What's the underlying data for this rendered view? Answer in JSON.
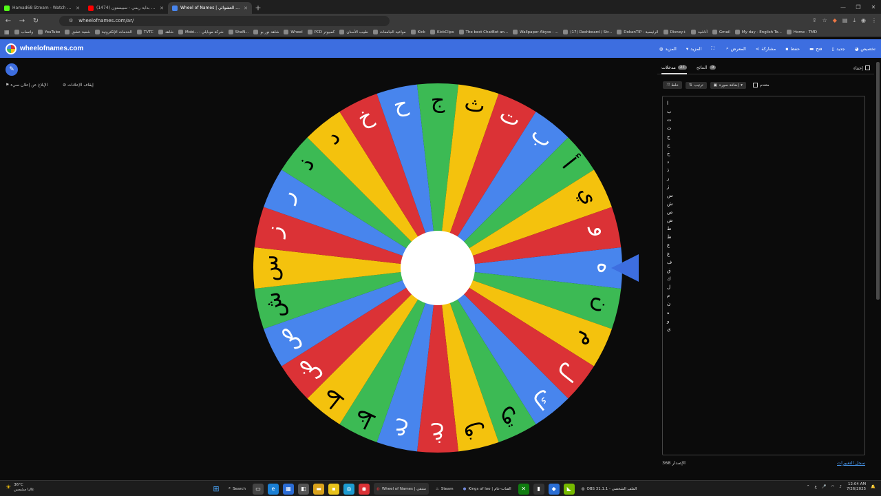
{
  "browser": {
    "tabs": [
      {
        "title": "Hamad68 Stream - Watch Live on Ki",
        "color": "#53fc18",
        "active": false
      },
      {
        "title": "(1474) أغنية بداية ريمي - سبيستون",
        "color": "#ff0000",
        "active": false
      },
      {
        "title": "Wheel of Names | اسم العشوائي",
        "color": "#4885ed",
        "active": true
      }
    ],
    "new_tab": "+",
    "url": "wheelofnames.com/ar/",
    "bookmarks": [
      "واتساب",
      "YouTube",
      "شعبة عشق",
      "الخدمات الإلكترونية",
      "TVTC",
      "شاهد",
      "Mobi... - شركة موبايلي",
      "ShaN...",
      "شاهد نور بو",
      "Wheel",
      "PCD كمبيوتر",
      "طبيب الأسنان",
      "مواعيد الجامعات",
      "Kick",
      "KickClips",
      "The best ChatBot an...",
      "Wallpaper Abyss - ...",
      "(17) Dashboard / Str...",
      "DokanTIP - الرئيسية",
      "Disney+",
      "أناشيد",
      "Gmail",
      "My day - English Te...",
      "Home - TMD"
    ]
  },
  "app": {
    "site_name": "wheelofnames.com",
    "menu": [
      {
        "label": "المزيد",
        "icon": "globe-icon"
      },
      {
        "label": "المزيد",
        "icon": "chevron-down-icon"
      },
      {
        "label": "",
        "icon": "fullscreen-icon"
      },
      {
        "label": "المعرض",
        "icon": "search-icon"
      },
      {
        "label": "مشاركة",
        "icon": "share-icon"
      },
      {
        "label": "حفظ",
        "icon": "save-icon"
      },
      {
        "label": "فتح",
        "icon": "folder-icon"
      },
      {
        "label": "جديد",
        "icon": "file-icon"
      },
      {
        "label": "تخصيص",
        "icon": "palette-icon"
      }
    ],
    "ads": {
      "report": "الإبلاغ عن إعلان سيء",
      "disable": "إيقاف الإعلانات"
    }
  },
  "wheel": {
    "segments": [
      "ه",
      "ن",
      "م",
      "ل",
      "ك",
      "ق",
      "ف",
      "غ",
      "ع",
      "ظ",
      "ط",
      "ض",
      "ص",
      "ش",
      "س",
      "ز",
      "ر",
      "ذ",
      "د",
      "خ",
      "ح",
      "ج",
      "ث",
      "ت",
      "ب",
      "أ",
      "ي",
      "و"
    ],
    "colors": [
      "#4885ed",
      "#3cba54",
      "#f4c20d",
      "#db3236"
    ],
    "label_colors": [
      "#ffffff",
      "#000000",
      "#000000",
      "#ffffff"
    ]
  },
  "panel": {
    "tab_entries": "مدخلات",
    "entries_count": "27",
    "tab_results": "النتائج",
    "results_count": "0",
    "hide": "إخفاء",
    "shuffle": "خلط",
    "sort": "ترتيب",
    "add_image": "إضافة صورة",
    "advanced": "متقدم",
    "entries": [
      "ا",
      "ب",
      "ت",
      "ث",
      "ج",
      "ح",
      "خ",
      "د",
      "ذ",
      "ر",
      "ز",
      "س",
      "ش",
      "ص",
      "ض",
      "ط",
      "ظ",
      "ع",
      "غ",
      "ف",
      "ق",
      "ك",
      "ل",
      "م",
      "ن",
      "ه",
      "و",
      "ي"
    ],
    "version": "الإصدار 368",
    "changelog": "سجل التغييرات"
  },
  "taskbar": {
    "weather_temp": "36°C",
    "weather_desc": "غالبا مشمس",
    "search": "Search",
    "apps": [
      "Wheel of Names | منتقي",
      "Steam",
      "Kings of loo | القنات-عام",
      "OBS 31.1.1 - الملف الشخصي"
    ],
    "time": "12:04 AM",
    "date": "7/26/2025",
    "lang": "ع"
  }
}
